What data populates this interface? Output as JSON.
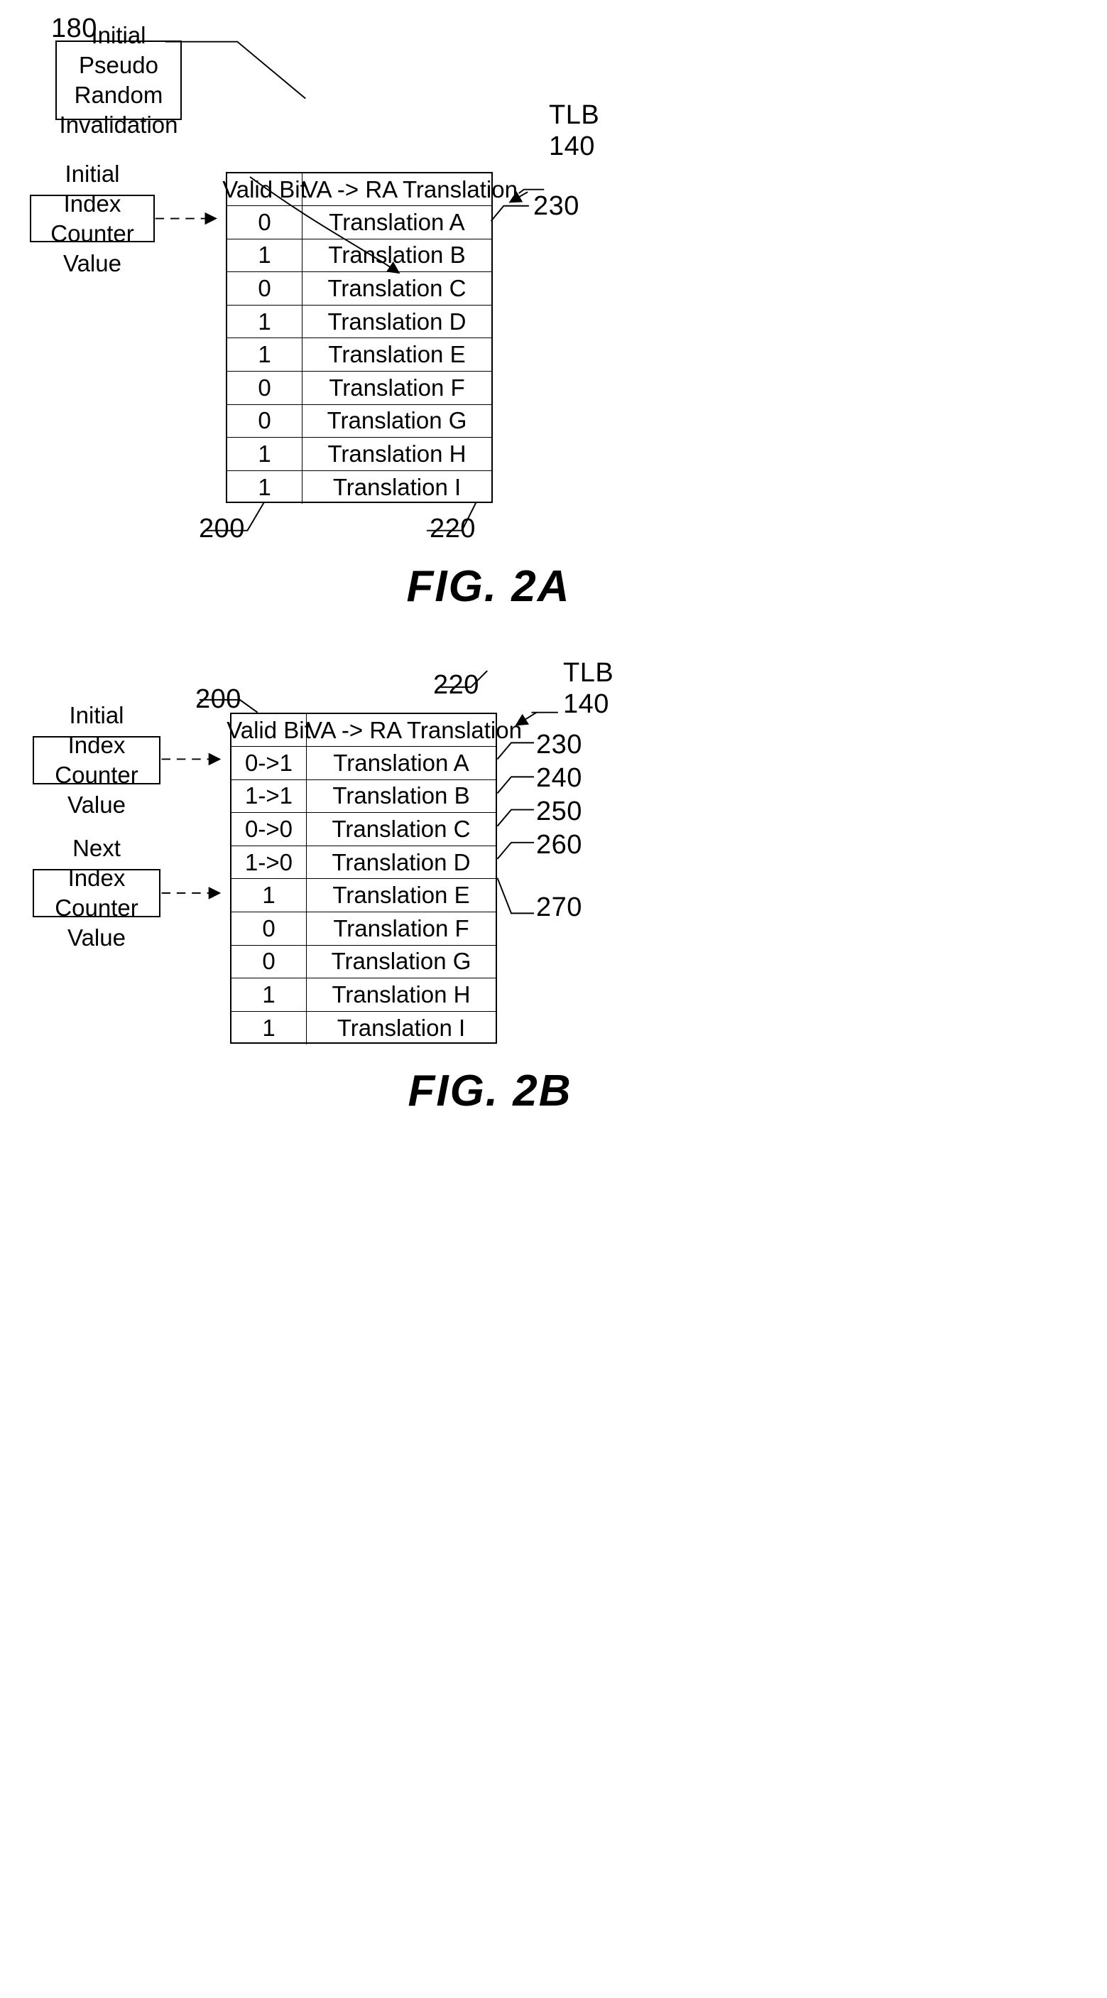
{
  "figures": [
    {
      "id": "fig2a",
      "caption": "FIG. 2A",
      "tlb_label": {
        "name": "TLB",
        "number": "140"
      },
      "callouts": [
        {
          "id": "180",
          "text": "180"
        },
        {
          "id": "230",
          "text": "230"
        },
        {
          "id": "200",
          "text": "200"
        },
        {
          "id": "220",
          "text": "220"
        }
      ],
      "boxes": [
        {
          "id": "initial-pseudo-random-invalidation",
          "lines": [
            "Initial Pseudo",
            "Random",
            "Invalidation"
          ]
        },
        {
          "id": "initial-index-counter-value",
          "lines": [
            "Initial Index",
            "Counter Value"
          ]
        }
      ],
      "table": {
        "headers": [
          "Valid Bit",
          "VA -> RA Translation"
        ],
        "rows": [
          {
            "valid": "0",
            "translation": "Translation A"
          },
          {
            "valid": "1",
            "translation": "Translation B"
          },
          {
            "valid": "0",
            "translation": "Translation C"
          },
          {
            "valid": "1",
            "translation": "Translation D"
          },
          {
            "valid": "1",
            "translation": "Translation E"
          },
          {
            "valid": "0",
            "translation": "Translation F"
          },
          {
            "valid": "0",
            "translation": "Translation G"
          },
          {
            "valid": "1",
            "translation": "Translation H"
          },
          {
            "valid": "1",
            "translation": "Translation I"
          }
        ]
      }
    },
    {
      "id": "fig2b",
      "caption": "FIG. 2B",
      "tlb_label": {
        "name": "TLB",
        "number": "140"
      },
      "callouts": [
        {
          "id": "200",
          "text": "200"
        },
        {
          "id": "220",
          "text": "220"
        },
        {
          "id": "230",
          "text": "230"
        },
        {
          "id": "240",
          "text": "240"
        },
        {
          "id": "250",
          "text": "250"
        },
        {
          "id": "260",
          "text": "260"
        },
        {
          "id": "270",
          "text": "270"
        }
      ],
      "boxes": [
        {
          "id": "initial-index-counter-value",
          "lines": [
            "Initial Index",
            "Counter Value"
          ]
        },
        {
          "id": "next-index-counter-value",
          "lines": [
            "Next Index",
            "Counter Value"
          ]
        }
      ],
      "table": {
        "headers": [
          "Valid Bit",
          "VA -> RA Translation"
        ],
        "rows": [
          {
            "valid": "0->1",
            "translation": "Translation A"
          },
          {
            "valid": "1->1",
            "translation": "Translation B"
          },
          {
            "valid": "0->0",
            "translation": "Translation C"
          },
          {
            "valid": "1->0",
            "translation": "Translation D"
          },
          {
            "valid": "1",
            "translation": "Translation E"
          },
          {
            "valid": "0",
            "translation": "Translation F"
          },
          {
            "valid": "0",
            "translation": "Translation G"
          },
          {
            "valid": "1",
            "translation": "Translation H"
          },
          {
            "valid": "1",
            "translation": "Translation I"
          }
        ]
      }
    }
  ]
}
